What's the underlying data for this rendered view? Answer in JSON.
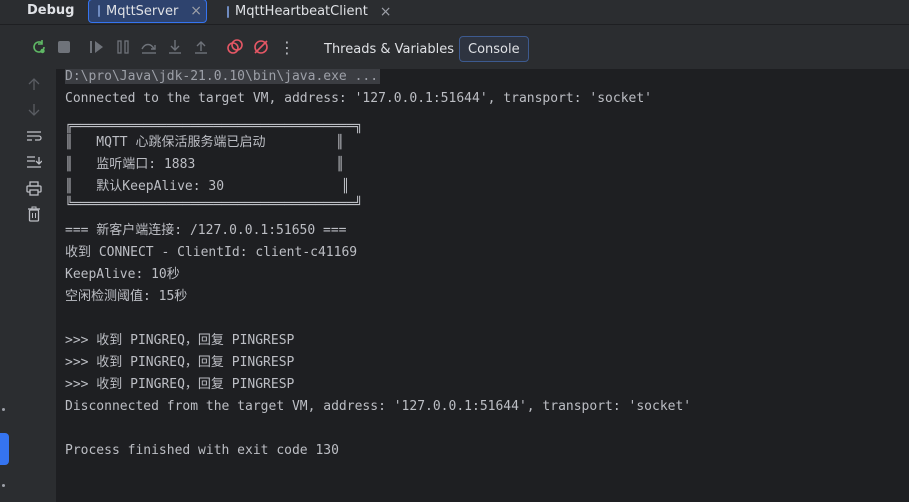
{
  "header": {
    "title": "Debug",
    "tabs": [
      {
        "label": "MqttServer",
        "active": true
      },
      {
        "label": "MqttHeartbeatClient",
        "active": false
      }
    ]
  },
  "toolbar": {
    "icons": [
      "rerun-icon",
      "stop-icon",
      "resume-icon",
      "pause-icon",
      "step-over-icon",
      "step-into-icon",
      "step-out-icon",
      "view-breakpoints-icon",
      "mute-breakpoints-icon",
      "more-icon"
    ],
    "tabs": [
      {
        "label": "Threads & Variables",
        "selected": false
      },
      {
        "label": "Console",
        "selected": true
      }
    ]
  },
  "gutter": {
    "icons": [
      "up-arrow-icon",
      "down-arrow-icon",
      "soft-wrap-icon",
      "scroll-to-end-icon",
      "print-icon",
      "trash-icon"
    ]
  },
  "console": {
    "command": "D:\\pro\\Java\\jdk-21.0.10\\bin\\java.exe ...",
    "connected": "Connected to the target VM, address: '127.0.0.1:51644', transport: 'socket'",
    "banner": [
      "╔════════════════════════════════════╗",
      "║   MQTT 心跳保活服务端已启动         ║",
      "║   监听端口: 1883                  ║",
      "║   默认KeepAlive: 30               ║",
      "╚════════════════════════════════════╝"
    ],
    "lines": [
      "=== 新客户端连接: /127.0.0.1:51650 ===",
      "收到 CONNECT - ClientId: client-c41169",
      "KeepAlive: 10秒",
      "空闲检测阈值: 15秒",
      "",
      ">>> 收到 PINGREQ，回复 PINGRESP",
      ">>> 收到 PINGREQ，回复 PINGRESP",
      ">>> 收到 PINGREQ，回复 PINGRESP",
      "Disconnected from the target VM, address: '127.0.0.1:51644', transport: 'socket'",
      "",
      "Process finished with exit code 130"
    ]
  },
  "colors": {
    "accent": "#3574f0",
    "rerun": "#5fb865",
    "breakpoint": "#e55765"
  }
}
